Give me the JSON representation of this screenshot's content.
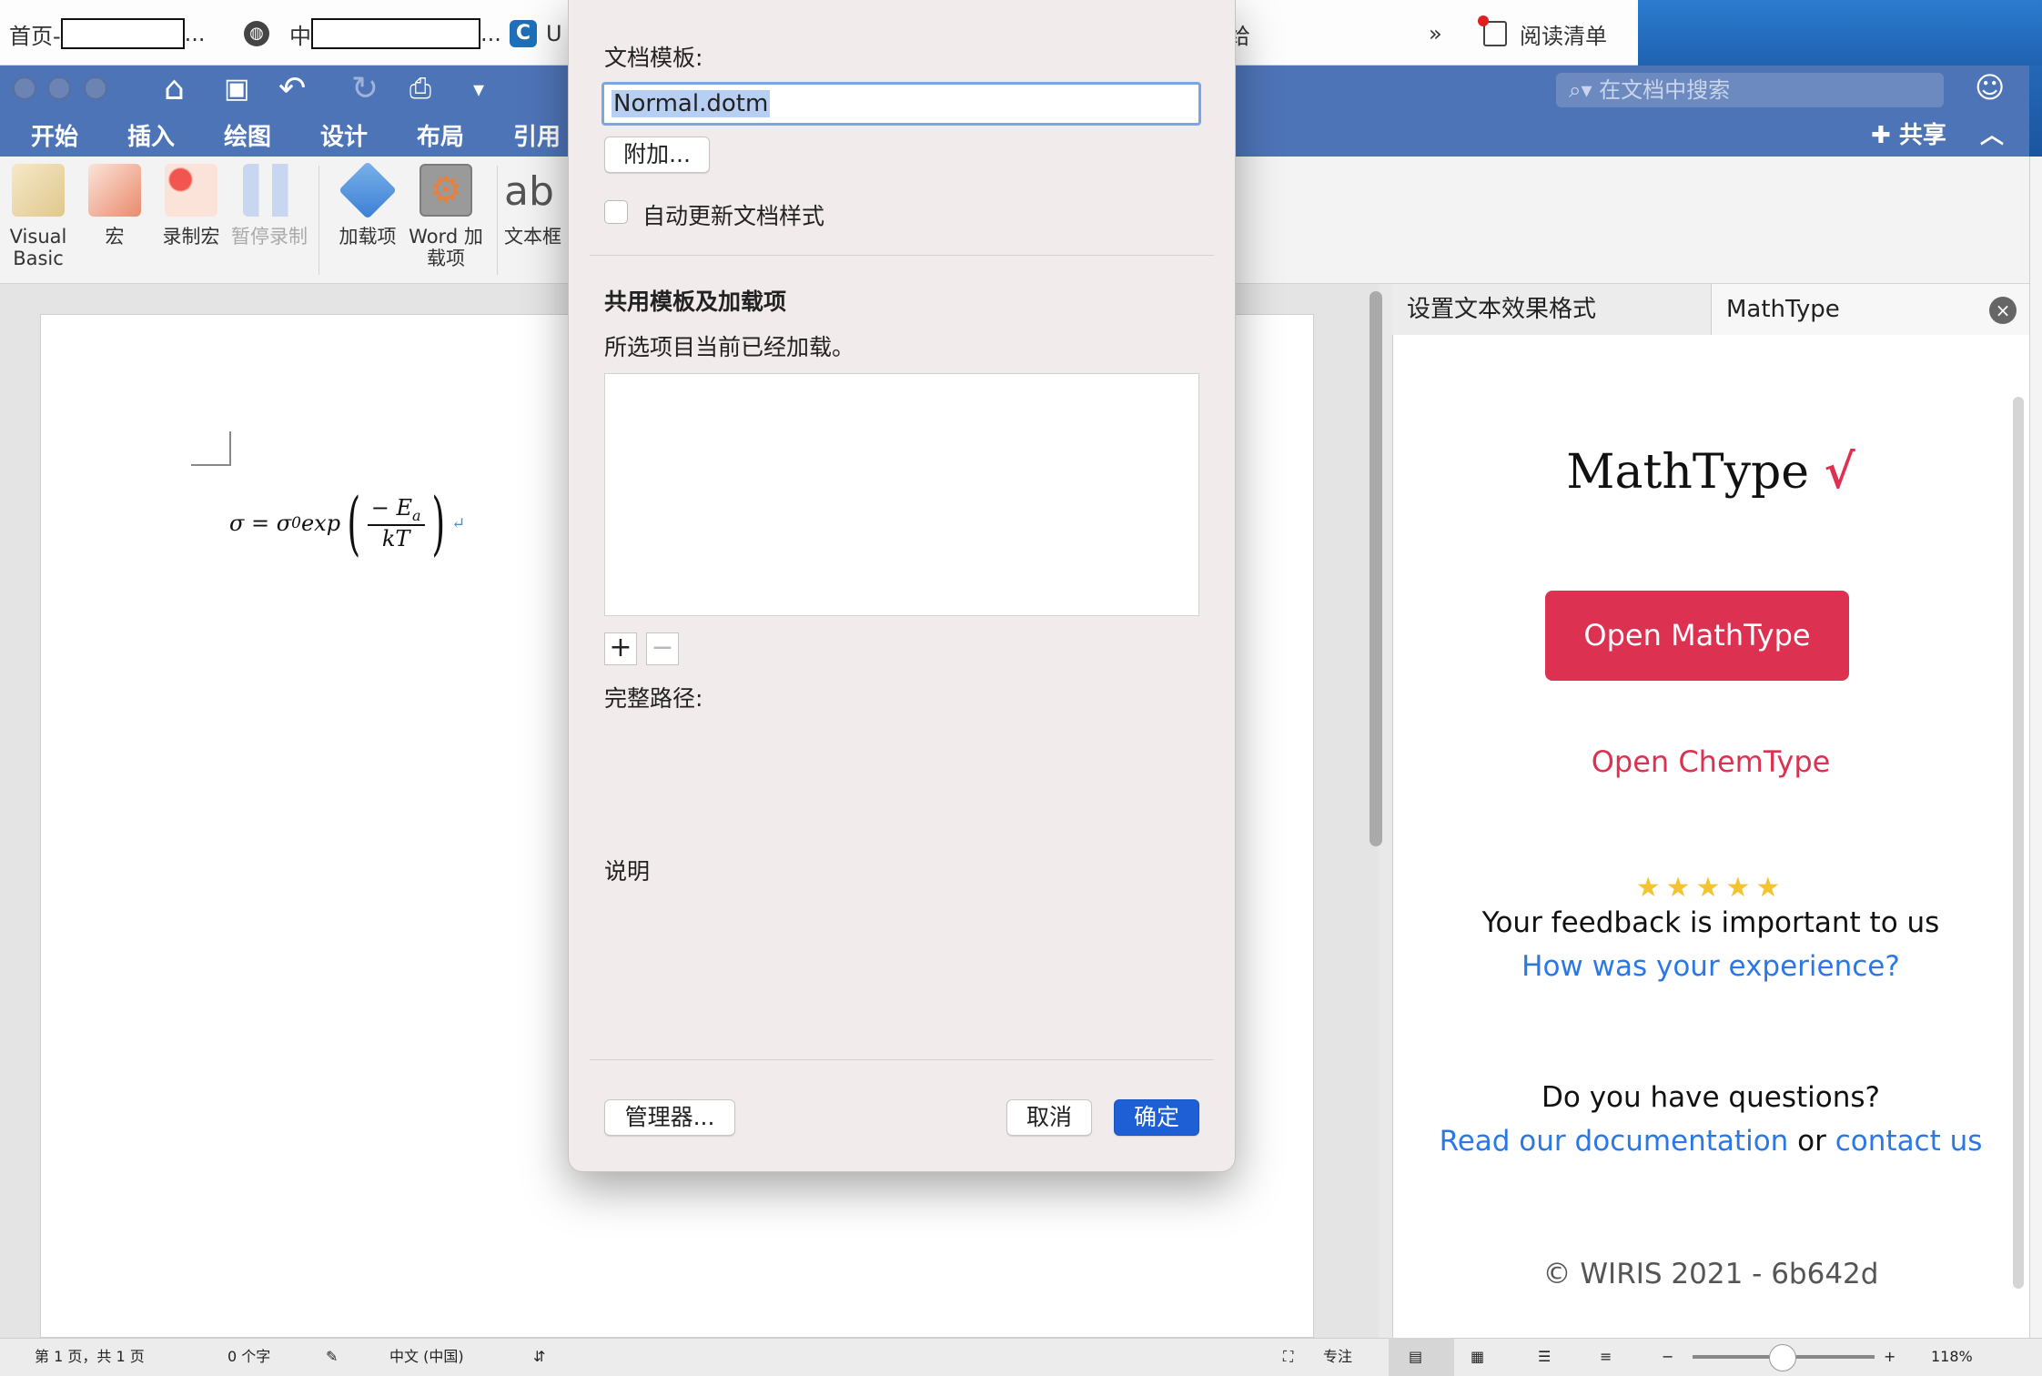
{
  "browser": {
    "bookmark_1": "首页-",
    "bookmark_1_tail": "...",
    "bookmark_2": "中",
    "bookmark_2_tail": "...",
    "bookmark_3": "U",
    "bookmark_4_tail": "给",
    "more": "»",
    "reading_list": "阅读清单"
  },
  "word": {
    "search_placeholder": "在文档中搜索",
    "share": "共享",
    "tabs": [
      "开始",
      "插入",
      "绘图",
      "设计",
      "布局",
      "引用"
    ],
    "ribbon": {
      "visual_basic": "Visual Basic",
      "macro": "宏",
      "record_macro": "录制宏",
      "pause_recording": "暂停录制",
      "addins": "加载项",
      "word_addins": "Word 加载项",
      "textbox": "文本框",
      "textbox_glyph": "ab"
    }
  },
  "document": {
    "formula": {
      "lhs": "σ = σ",
      "sub0": "0",
      "func": "exp",
      "numerator": "− E",
      "sub_a": "a",
      "denominator": "kT"
    }
  },
  "pane": {
    "tab_format": "设置文本效果格式",
    "tab_mathtype": "MathType",
    "close": "×",
    "logo": "MathType",
    "open_mathtype": "Open MathType",
    "open_chemtype": "Open ChemType",
    "stars": "★★★★★",
    "feedback": "Your feedback is important to us",
    "experience": "How was your experience?",
    "questions": "Do you have questions?",
    "read_docs": "Read our documentation",
    "or": "or",
    "contact": "contact us",
    "copyright": "© WIRIS 2021 - 6b642d",
    "accent_color": "#dd3151",
    "link_color": "#2b78e4"
  },
  "status": {
    "page": "第 1 页，共 1 页",
    "words": "0 个字",
    "language": "中文 (中国)",
    "focus": "专注",
    "zoom": "118%"
  },
  "dialog": {
    "doc_template_label": "文档模板:",
    "template_value": "Normal.dotm",
    "attach": "附加...",
    "auto_update": "自动更新文档样式",
    "auto_update_checked": false,
    "shared_heading": "共用模板及加载项",
    "loaded_note": "所选项目当前已经加载。",
    "add": "+",
    "remove": "−",
    "full_path": "完整路径:",
    "description": "说明",
    "organizer": "管理器...",
    "cancel": "取消",
    "ok": "确定"
  }
}
